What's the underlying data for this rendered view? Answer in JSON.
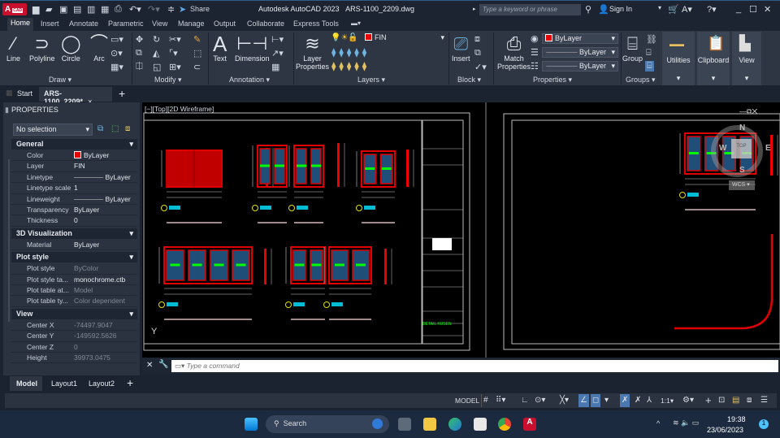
{
  "titlebar": {
    "app_logo": "A",
    "app_logo_sub": "CAD",
    "share": "Share",
    "title": "Autodesk AutoCAD 2023",
    "file": "ARS-1100_2209.dwg",
    "search_placeholder": "Type a keyword or phrase",
    "sign_in": "Sign In"
  },
  "ribbon_tabs": [
    "Home",
    "Insert",
    "Annotate",
    "Parametric",
    "View",
    "Manage",
    "Output",
    "Collaborate",
    "Express Tools"
  ],
  "ribbon": {
    "draw": {
      "label": "Draw",
      "line": "Line",
      "polyline": "Polyline",
      "circle": "Circle",
      "arc": "Arc"
    },
    "modify": {
      "label": "Modify"
    },
    "annotation": {
      "label": "Annotation",
      "text": "Text",
      "dimension": "Dimension"
    },
    "layers": {
      "label": "Layers",
      "layer_properties_1": "Layer",
      "layer_properties_2": "Properties",
      "current_layer": "FIN"
    },
    "block": {
      "label": "Block",
      "insert": "Insert"
    },
    "properties": {
      "label": "Properties",
      "match_1": "Match",
      "match_2": "Properties",
      "color": "ByLayer",
      "lineweight": "ByLayer",
      "linetype": "ByLayer"
    },
    "groups": {
      "label": "Groups",
      "group": "Group"
    },
    "utilities": "Utilities",
    "clipboard": "Clipboard",
    "view": "View"
  },
  "doc_tabs": {
    "start": "Start",
    "active": "ARS-1100_2209*"
  },
  "properties_panel": {
    "title": "PROPERTIES",
    "selection": "No selection",
    "sections": [
      {
        "name": "General",
        "rows": [
          [
            "Color",
            "ByLayer"
          ],
          [
            "Layer",
            "FIN"
          ],
          [
            "Linetype",
            "ByLayer"
          ],
          [
            "Linetype scale",
            "1"
          ],
          [
            "Lineweight",
            "ByLayer"
          ],
          [
            "Transparency",
            "ByLayer"
          ],
          [
            "Thickness",
            "0"
          ]
        ]
      },
      {
        "name": "3D Visualization",
        "rows": [
          [
            "Material",
            "ByLayer"
          ]
        ]
      },
      {
        "name": "Plot style",
        "rows": [
          [
            "Plot style",
            "ByColor"
          ],
          [
            "Plot style ta...",
            "monochrome.ctb"
          ],
          [
            "Plot table at...",
            "Model"
          ],
          [
            "Plot table ty...",
            "Color dependent"
          ]
        ]
      },
      {
        "name": "View",
        "rows": [
          [
            "Center X",
            "-74497.9047"
          ],
          [
            "Center Y",
            "-149592.5626"
          ],
          [
            "Center Z",
            "0"
          ],
          [
            "Height",
            "39973.0475"
          ]
        ]
      }
    ]
  },
  "viewport": {
    "label": "[−][Top][2D Wireframe]",
    "viewcube": {
      "n": "N",
      "s": "S",
      "e": "E",
      "w": "W",
      "top": "TOP",
      "wcs": "WCS"
    },
    "sheet_title": "DETAIL KUSEN",
    "ucs_y": "Y"
  },
  "command": {
    "placeholder": "Type a command"
  },
  "layout_tabs": [
    "Model",
    "Layout1",
    "Layout2"
  ],
  "status": {
    "model": "MODEL",
    "scale": "1:1"
  },
  "taskbar": {
    "search": "Search",
    "time": "19:38",
    "date": "23/06/2023",
    "notifications": "1"
  },
  "colors": {
    "accent": "#4a78b0",
    "frame_red": "#e00000",
    "glass": "#1f4e79",
    "dim_green": "#00ff00"
  }
}
